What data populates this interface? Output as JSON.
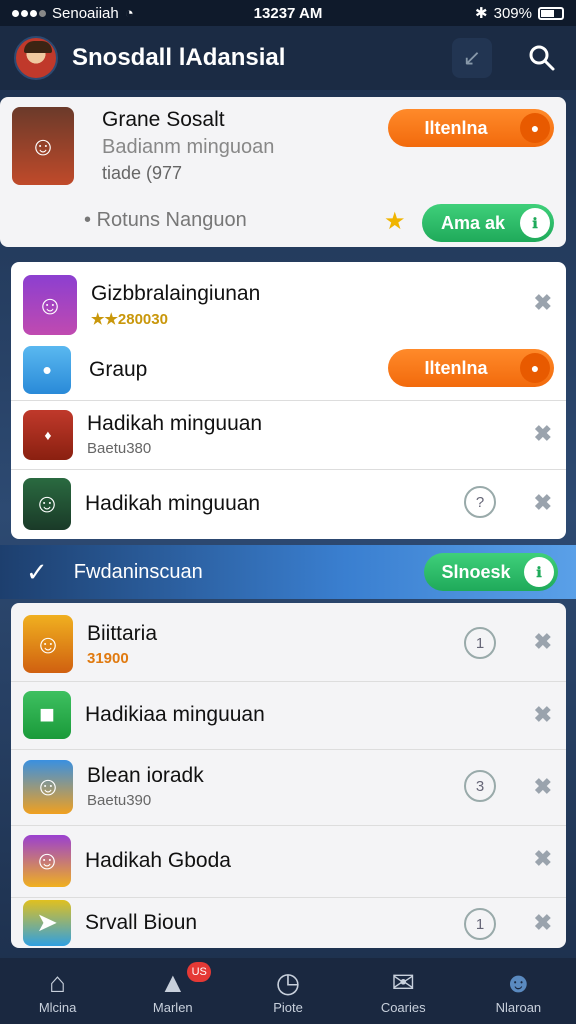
{
  "status_bar": {
    "carrier": "Senoaiiah",
    "time": "13237 AM",
    "battery": "309%"
  },
  "header": {
    "title": "Snosdall lAdansial"
  },
  "featured": {
    "title": "Grane Sosalt",
    "subtitle": "Badianm minguoan",
    "meta": "tiade (977",
    "note": "Rotuns Nanguon",
    "action_label": "Iltenlna",
    "secondary_label": "Ama ak"
  },
  "group1": [
    {
      "title": "Gizbbralaingiunan",
      "sub": "★★280030"
    },
    {
      "title": "Graup",
      "sub": "",
      "action_label": "Iltenlna"
    },
    {
      "title": "Hadikah minguuan",
      "sub": "Baetu380"
    },
    {
      "title": "Hadikah minguuan",
      "sub": "",
      "badge": "?"
    }
  ],
  "section": {
    "label": "Fwdaninscuan",
    "action_label": "Slnoesk"
  },
  "group2": [
    {
      "title": "Biittaria",
      "sub": "31900",
      "badge": "1"
    },
    {
      "title": "Hadikiaa minguuan",
      "sub": ""
    },
    {
      "title": "Blean ioradk",
      "sub": "Baetu390",
      "badge": "3"
    },
    {
      "title": "Hadikah Gboda",
      "sub": ""
    },
    {
      "title": "Srvall Bioun",
      "sub": "",
      "badge": "1"
    }
  ],
  "nav": [
    {
      "label": "Mlcina",
      "icon": "home-icon"
    },
    {
      "label": "Marlen",
      "icon": "chat-icon",
      "badge": "US"
    },
    {
      "label": "Piote",
      "icon": "clock-icon"
    },
    {
      "label": "Coaries",
      "icon": "mail-icon"
    },
    {
      "label": "Nlaroan",
      "icon": "person-icon"
    }
  ],
  "colors": {
    "accent_orange": "#f26a0c",
    "accent_green": "#1faa5a",
    "header_bg": "#1b2b44",
    "banner_blue": "#3a7fd0"
  }
}
